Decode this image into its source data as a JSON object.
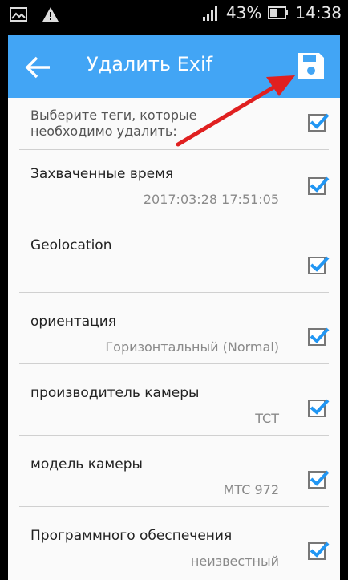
{
  "status_bar": {
    "battery_percent": "43%",
    "time": "14:38"
  },
  "toolbar": {
    "title": "Удалить Exif"
  },
  "header": {
    "text": "Выберите теги, которые необходимо удалить:"
  },
  "items": [
    {
      "label": "Захваченные время",
      "value": "2017:03:28 17:51:05"
    },
    {
      "label": "Geolocation",
      "value": ""
    },
    {
      "label": "ориентация",
      "value": "Горизонтальный (Normal)"
    },
    {
      "label": "производитель камеры",
      "value": "TCT"
    },
    {
      "label": "модель камеры",
      "value": "MTC 972"
    },
    {
      "label": "Программного обеспечения",
      "value": "неизвестный"
    }
  ],
  "colors": {
    "toolbar": "#42a5f5",
    "checkmark": "#2196f3",
    "annotation_arrow": "#e02020"
  }
}
